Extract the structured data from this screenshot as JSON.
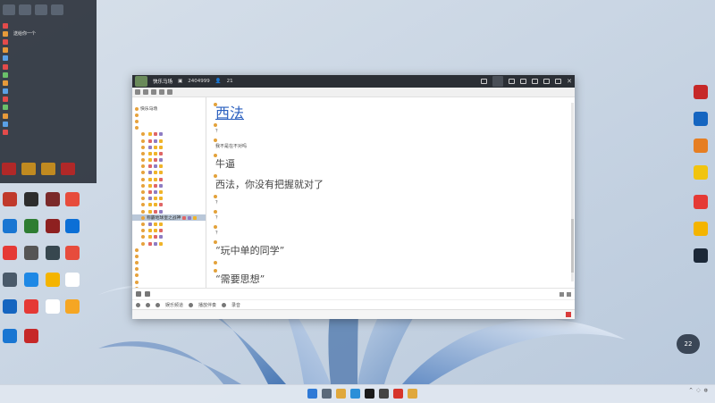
{
  "overlay": {
    "rows": [
      {
        "name": "",
        "text": "",
        "color": "#e34b4b"
      },
      {
        "name": "",
        "text": "送给你一个",
        "color": "#e69a3a"
      },
      {
        "name": "",
        "text": "",
        "color": "#e34b4b"
      },
      {
        "name": "",
        "text": "",
        "color": "#e69a3a"
      },
      {
        "name": "",
        "text": "",
        "color": "#5aa0e6"
      },
      {
        "name": "",
        "text": "",
        "color": "#e34b4b"
      },
      {
        "name": "",
        "text": "",
        "color": "#6ac06a"
      },
      {
        "name": "",
        "text": "",
        "color": "#e69a3a"
      },
      {
        "name": "",
        "text": "",
        "color": "#5aa0e6"
      },
      {
        "name": "",
        "text": "",
        "color": "#e34b4b"
      },
      {
        "name": "",
        "text": "",
        "color": "#6ac06a"
      },
      {
        "name": "",
        "text": "",
        "color": "#e69a3a"
      },
      {
        "name": "",
        "text": "",
        "color": "#5aa0e6"
      },
      {
        "name": "",
        "text": "",
        "color": "#e34b4b"
      }
    ],
    "footer": ""
  },
  "window": {
    "title": "快乐马场",
    "room_id": "2404999",
    "count": "21",
    "sidebar": {
      "header_left": "",
      "header_right": "",
      "rows": [
        {
          "label": "快乐马场",
          "indent": false,
          "state": "group"
        },
        {
          "label": "",
          "indent": false,
          "state": ""
        },
        {
          "label": "",
          "indent": false,
          "state": ""
        },
        {
          "label": "",
          "indent": false,
          "state": ""
        },
        {
          "label": "",
          "indent": true,
          "state": ""
        },
        {
          "label": "",
          "indent": true,
          "state": ""
        },
        {
          "label": "",
          "indent": true,
          "state": ""
        },
        {
          "label": "",
          "indent": true,
          "state": ""
        },
        {
          "label": "",
          "indent": true,
          "state": ""
        },
        {
          "label": "",
          "indent": true,
          "state": ""
        },
        {
          "label": "",
          "indent": true,
          "state": ""
        },
        {
          "label": "",
          "indent": true,
          "state": ""
        },
        {
          "label": "",
          "indent": true,
          "state": ""
        },
        {
          "label": "",
          "indent": true,
          "state": ""
        },
        {
          "label": "",
          "indent": true,
          "state": ""
        },
        {
          "label": "",
          "indent": true,
          "state": ""
        },
        {
          "label": "",
          "indent": true,
          "state": ""
        },
        {
          "label": "称霸地球皇之战神",
          "indent": true,
          "state": "selected"
        },
        {
          "label": "",
          "indent": true,
          "state": ""
        },
        {
          "label": "",
          "indent": true,
          "state": ""
        },
        {
          "label": "",
          "indent": true,
          "state": ""
        },
        {
          "label": "",
          "indent": true,
          "state": ""
        },
        {
          "label": "",
          "indent": false,
          "state": ""
        },
        {
          "label": "",
          "indent": false,
          "state": ""
        },
        {
          "label": "",
          "indent": false,
          "state": "red"
        },
        {
          "label": "",
          "indent": false,
          "state": ""
        },
        {
          "label": "",
          "indent": false,
          "state": ""
        },
        {
          "label": "",
          "indent": false,
          "state": ""
        },
        {
          "label": "",
          "indent": false,
          "state": ""
        },
        {
          "label": "",
          "indent": false,
          "state": ""
        },
        {
          "label": "",
          "indent": false,
          "state": ""
        },
        {
          "label": "",
          "indent": false,
          "state": ""
        },
        {
          "label": "",
          "indent": false,
          "state": ""
        }
      ]
    },
    "messages": [
      {
        "meta": "",
        "text": "西法",
        "style": "link"
      },
      {
        "meta": "",
        "text": "？",
        "style": "sm"
      },
      {
        "meta": "",
        "text": "我不是在不对吗",
        "style": "sm"
      },
      {
        "meta": "",
        "text": "牛逼",
        "style": "big"
      },
      {
        "meta": "",
        "text": "西法，你没有把握就对了",
        "style": "big"
      },
      {
        "meta": "",
        "text": "？",
        "style": "sm"
      },
      {
        "meta": "",
        "text": "？",
        "style": "sm"
      },
      {
        "meta": "",
        "text": "？",
        "style": "sm"
      },
      {
        "meta": "",
        "text": "“玩中单的同学”",
        "style": "big"
      },
      {
        "meta": "",
        "text": "",
        "style": "sm"
      },
      {
        "meta": "",
        "text": "“需要思想”",
        "style": "big"
      }
    ],
    "input_bar": {
      "channel": "娱乐频道",
      "accompany": "播放伴奏",
      "record": "录音"
    },
    "footer": {
      "status": "",
      "right_label": ""
    }
  },
  "desktop_left": [
    {
      "label": "",
      "color": "#c0392b"
    },
    {
      "label": "",
      "color": "#2d2d2d"
    },
    {
      "label": "",
      "color": "#7b2a2a"
    },
    {
      "label": "",
      "color": "#e74c3c"
    },
    {
      "label": "",
      "color": "#1976d2"
    },
    {
      "label": "",
      "color": "#2e7d32"
    },
    {
      "label": "",
      "color": "#8e2020"
    },
    {
      "label": "",
      "color": "#0b6fd6"
    },
    {
      "label": "",
      "color": "#e53935"
    },
    {
      "label": "",
      "color": "#555555"
    },
    {
      "label": "",
      "color": "#37474f"
    },
    {
      "label": "",
      "color": "#e74c3c"
    },
    {
      "label": "",
      "color": "#4a5a6a"
    },
    {
      "label": "",
      "color": "#1e88e5"
    },
    {
      "label": "",
      "color": "#f4b400"
    },
    {
      "label": "",
      "color": "#ffffff"
    },
    {
      "label": "",
      "color": "#1565c0"
    },
    {
      "label": "",
      "color": "#e53935"
    },
    {
      "label": "",
      "color": "#ffffff"
    },
    {
      "label": "",
      "color": "#f5a623"
    },
    {
      "label": "",
      "color": "#1976d2"
    },
    {
      "label": "",
      "color": "#c62828"
    }
  ],
  "desktop_right": [
    {
      "label": "",
      "color": "#c62828"
    },
    {
      "label": "",
      "color": "#1565c0"
    },
    {
      "label": "",
      "color": "#e67e22"
    },
    {
      "label": "",
      "color": "#f1c40f"
    },
    {
      "label": "",
      "color": "#e53935"
    },
    {
      "label": "",
      "color": "#f4b400"
    },
    {
      "label": "",
      "color": "#1b2838"
    }
  ],
  "float_badge": "22",
  "clock": {
    "time": "",
    "date": ""
  }
}
